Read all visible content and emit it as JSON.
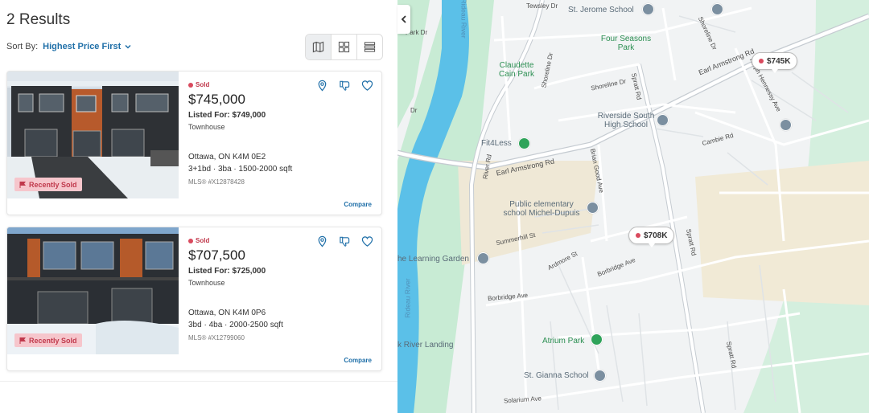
{
  "results": {
    "title": "2 Results"
  },
  "sort": {
    "label": "Sort By:",
    "value": "Highest Price First"
  },
  "view_modes": [
    "map",
    "grid",
    "list"
  ],
  "listings": [
    {
      "status": "Sold",
      "price": "$745,000",
      "listed_for": "Listed For: $749,000",
      "type": "Townhouse",
      "address": "Ottawa, ON K4M 0E2",
      "specs": "3+1bd · 3ba · 1500-2000 sqft",
      "mls": "MLS® #X12878428",
      "badge": "Recently Sold",
      "compare": "Compare"
    },
    {
      "status": "Sold",
      "price": "$707,500",
      "listed_for": "Listed For: $725,000",
      "type": "Townhouse",
      "address": "Ottawa, ON K4M 0P6",
      "specs": "3bd · 4ba · 2000-2500 sqft",
      "mls": "MLS® #X12799060",
      "badge": "Recently Sold",
      "compare": "Compare"
    }
  ],
  "map": {
    "pins": [
      "$745K",
      "$708K"
    ],
    "places": {
      "st_jerome": "St. Jerome School",
      "four_seasons": "Four Seasons Park",
      "claudette": "Claudette Cain Park",
      "riverside": "Riverside South High School",
      "fit4less": "Fit4Less",
      "public_school": "Public elementary school Michel-Dupuis",
      "learning_garden": "he Learning Garden",
      "atrium": "Atrium Park",
      "st_gianna": "St. Gianna School",
      "river_landing": "k River Landing"
    },
    "roads": {
      "earl_armstrong_1": "Earl Armstrong Rd",
      "earl_armstrong_2": "Earl Armstrong Rd",
      "spratt_1": "Spratt Rd",
      "spratt_2": "Spratt Rd",
      "spratt_3": "Spratt Rd",
      "river_rd": "River Rd",
      "shoreline_1": "Shoreline Dr",
      "shoreline_2": "Shoreline Dr",
      "shoreline_3": "Shoreline Dr",
      "ralph": "Ralph Hennessy Ave",
      "cambie": "Cambie Rd",
      "brian_good": "Brian Good Ave",
      "summerhill": "Summerhill St",
      "ardmore": "Ardmore St",
      "borbridge_1": "Borbridge Ave",
      "borbridge_2": "Borbridge Ave",
      "solarium": "Solarium Ave",
      "tewsley": "Tewsley Dr",
      "park_dr": "Park Dr",
      "dr": "Dr"
    },
    "rivers": {
      "rideau_1": "Rideau River",
      "rideau_2": "Rideau River"
    }
  }
}
